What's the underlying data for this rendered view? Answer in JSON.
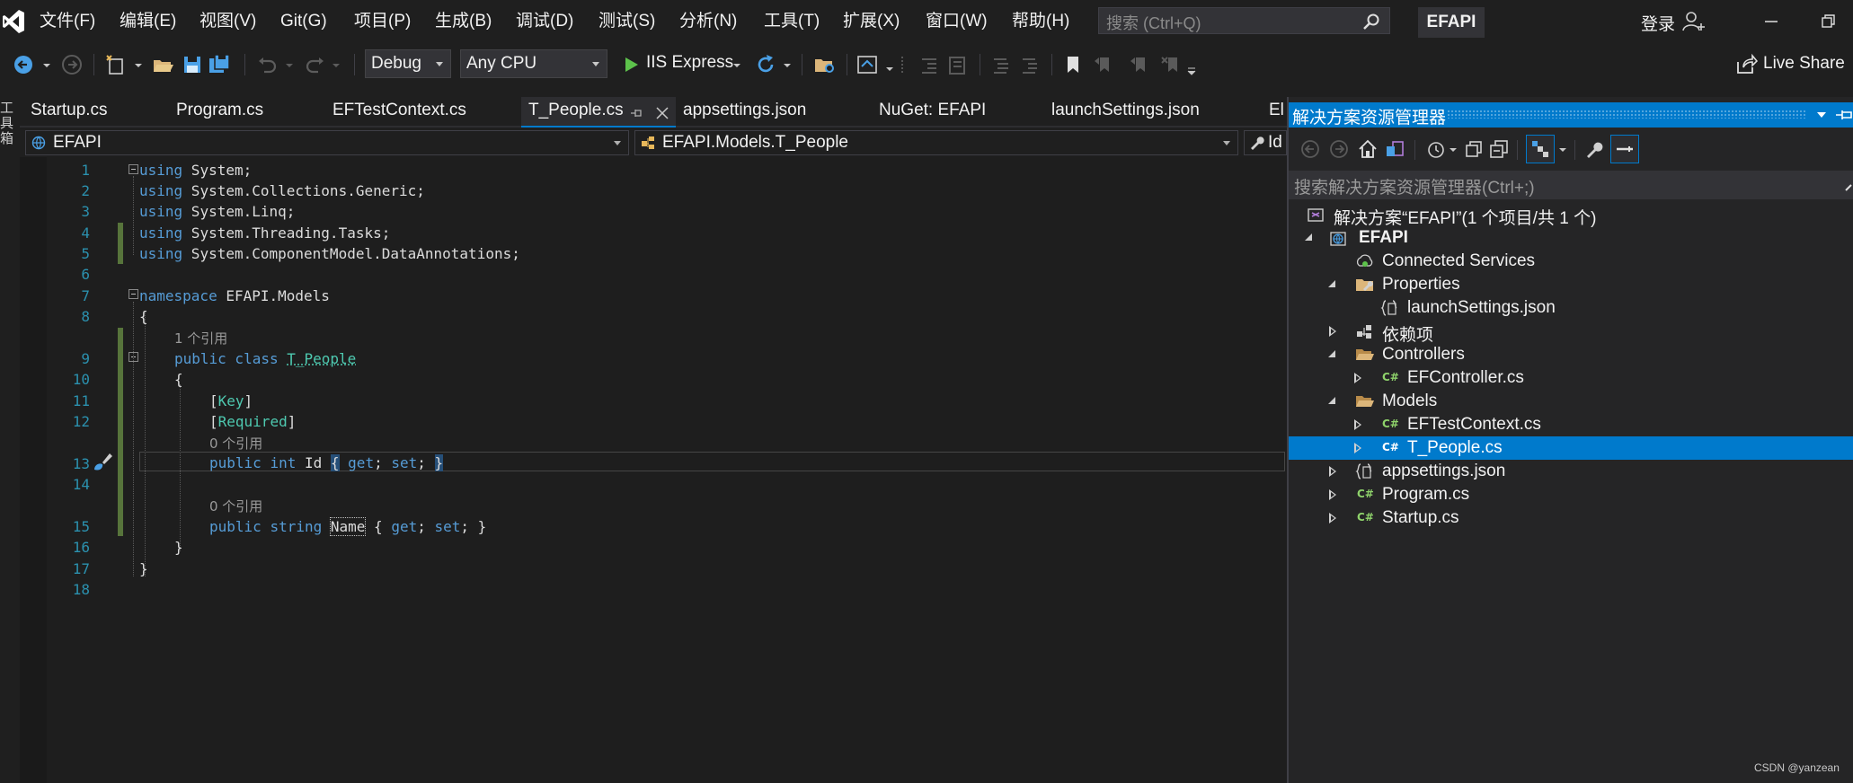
{
  "menu": {
    "items": [
      "文件(F)",
      "编辑(E)",
      "视图(V)",
      "Git(G)",
      "项目(P)",
      "生成(B)",
      "调试(D)",
      "测试(S)",
      "分析(N)",
      "工具(T)",
      "扩展(X)",
      "窗口(W)",
      "帮助(H)"
    ],
    "search_placeholder": "搜索 (Ctrl+Q)",
    "project_name": "EFAPI",
    "login": "登录"
  },
  "toolbar": {
    "configuration": "Debug",
    "platform": "Any CPU",
    "run_target": "IIS Express",
    "live_share": "Live Share"
  },
  "left_strip": {
    "toolbox_label": "工具箱"
  },
  "tabs": [
    "Startup.cs",
    "Program.cs",
    "EFTestContext.cs",
    "T_People.cs",
    "appsettings.json",
    "NuGet: EFAPI",
    "launchSettings.json",
    "El"
  ],
  "active_tab": "T_People.cs",
  "nav_bar": {
    "project": "EFAPI",
    "type": "EFAPI.Models.T_People",
    "member": "Id"
  },
  "editor": {
    "line_numbers": [
      "1",
      "2",
      "3",
      "4",
      "5",
      "6",
      "7",
      "8",
      "9",
      "10",
      "11",
      "12",
      "13",
      "14",
      "15",
      "16",
      "17",
      "18"
    ],
    "lines": [
      {
        "kw": "using",
        "rest": " System;"
      },
      {
        "kw": "using",
        "rest": " System.Collections.Generic;"
      },
      {
        "kw": "using",
        "rest": " System.Linq;"
      },
      {
        "kw": "using",
        "rest": " System.Threading.Tasks;"
      },
      {
        "kw": "using",
        "rest": " System.ComponentModel.DataAnnotations;"
      },
      {
        "kw": "namespace",
        "rest": " EFAPI.Models"
      },
      {
        "text": "{"
      },
      {
        "text": "1 个引用"
      },
      {
        "kw": "public class",
        "cls": "T_People"
      },
      {
        "text": "{"
      },
      {
        "attr_open": "[",
        "attr": "Key",
        "attr_close": "]"
      },
      {
        "attr_open": "[",
        "attr": "Required",
        "attr_close": "]"
      },
      {
        "text": "0 个引用"
      },
      {
        "kw1": "public",
        "kw2": "int",
        "name": "Id",
        "body_open": "{",
        "get": "get",
        "set": "set",
        "body_close": "}"
      },
      {
        "text": "0 个引用"
      },
      {
        "kw1": "public",
        "kw2": "string",
        "name": "Name",
        "body_open": "{",
        "get": "get",
        "set": "set",
        "body_close": "}"
      },
      {
        "text": "}"
      },
      {
        "text": "}"
      }
    ]
  },
  "solution_explorer": {
    "title": "解决方案资源管理器",
    "search_placeholder": "搜索解决方案资源管理器(Ctrl+;)",
    "items": [
      {
        "label": "解决方案“EFAPI”(1 个项目/共 1 个)"
      },
      {
        "label": "EFAPI"
      },
      {
        "label": "Connected Services"
      },
      {
        "label": "Properties"
      },
      {
        "label": "launchSettings.json"
      },
      {
        "label": "依赖项"
      },
      {
        "label": "Controllers"
      },
      {
        "label": "EFController.cs"
      },
      {
        "label": "Models"
      },
      {
        "label": "EFTestContext.cs"
      },
      {
        "label": "T_People.cs"
      },
      {
        "label": "appsettings.json"
      },
      {
        "label": "Program.cs"
      },
      {
        "label": "Startup.cs"
      }
    ],
    "selected": "T_People.cs",
    "csharp_badge": "C#"
  },
  "watermark": "CSDN @yanzean",
  "colors": {
    "accent": "#007acc",
    "keyword": "#569cd6",
    "type": "#4ec9b0",
    "line_number": "#2b91af",
    "change_bar": "#57743b"
  }
}
